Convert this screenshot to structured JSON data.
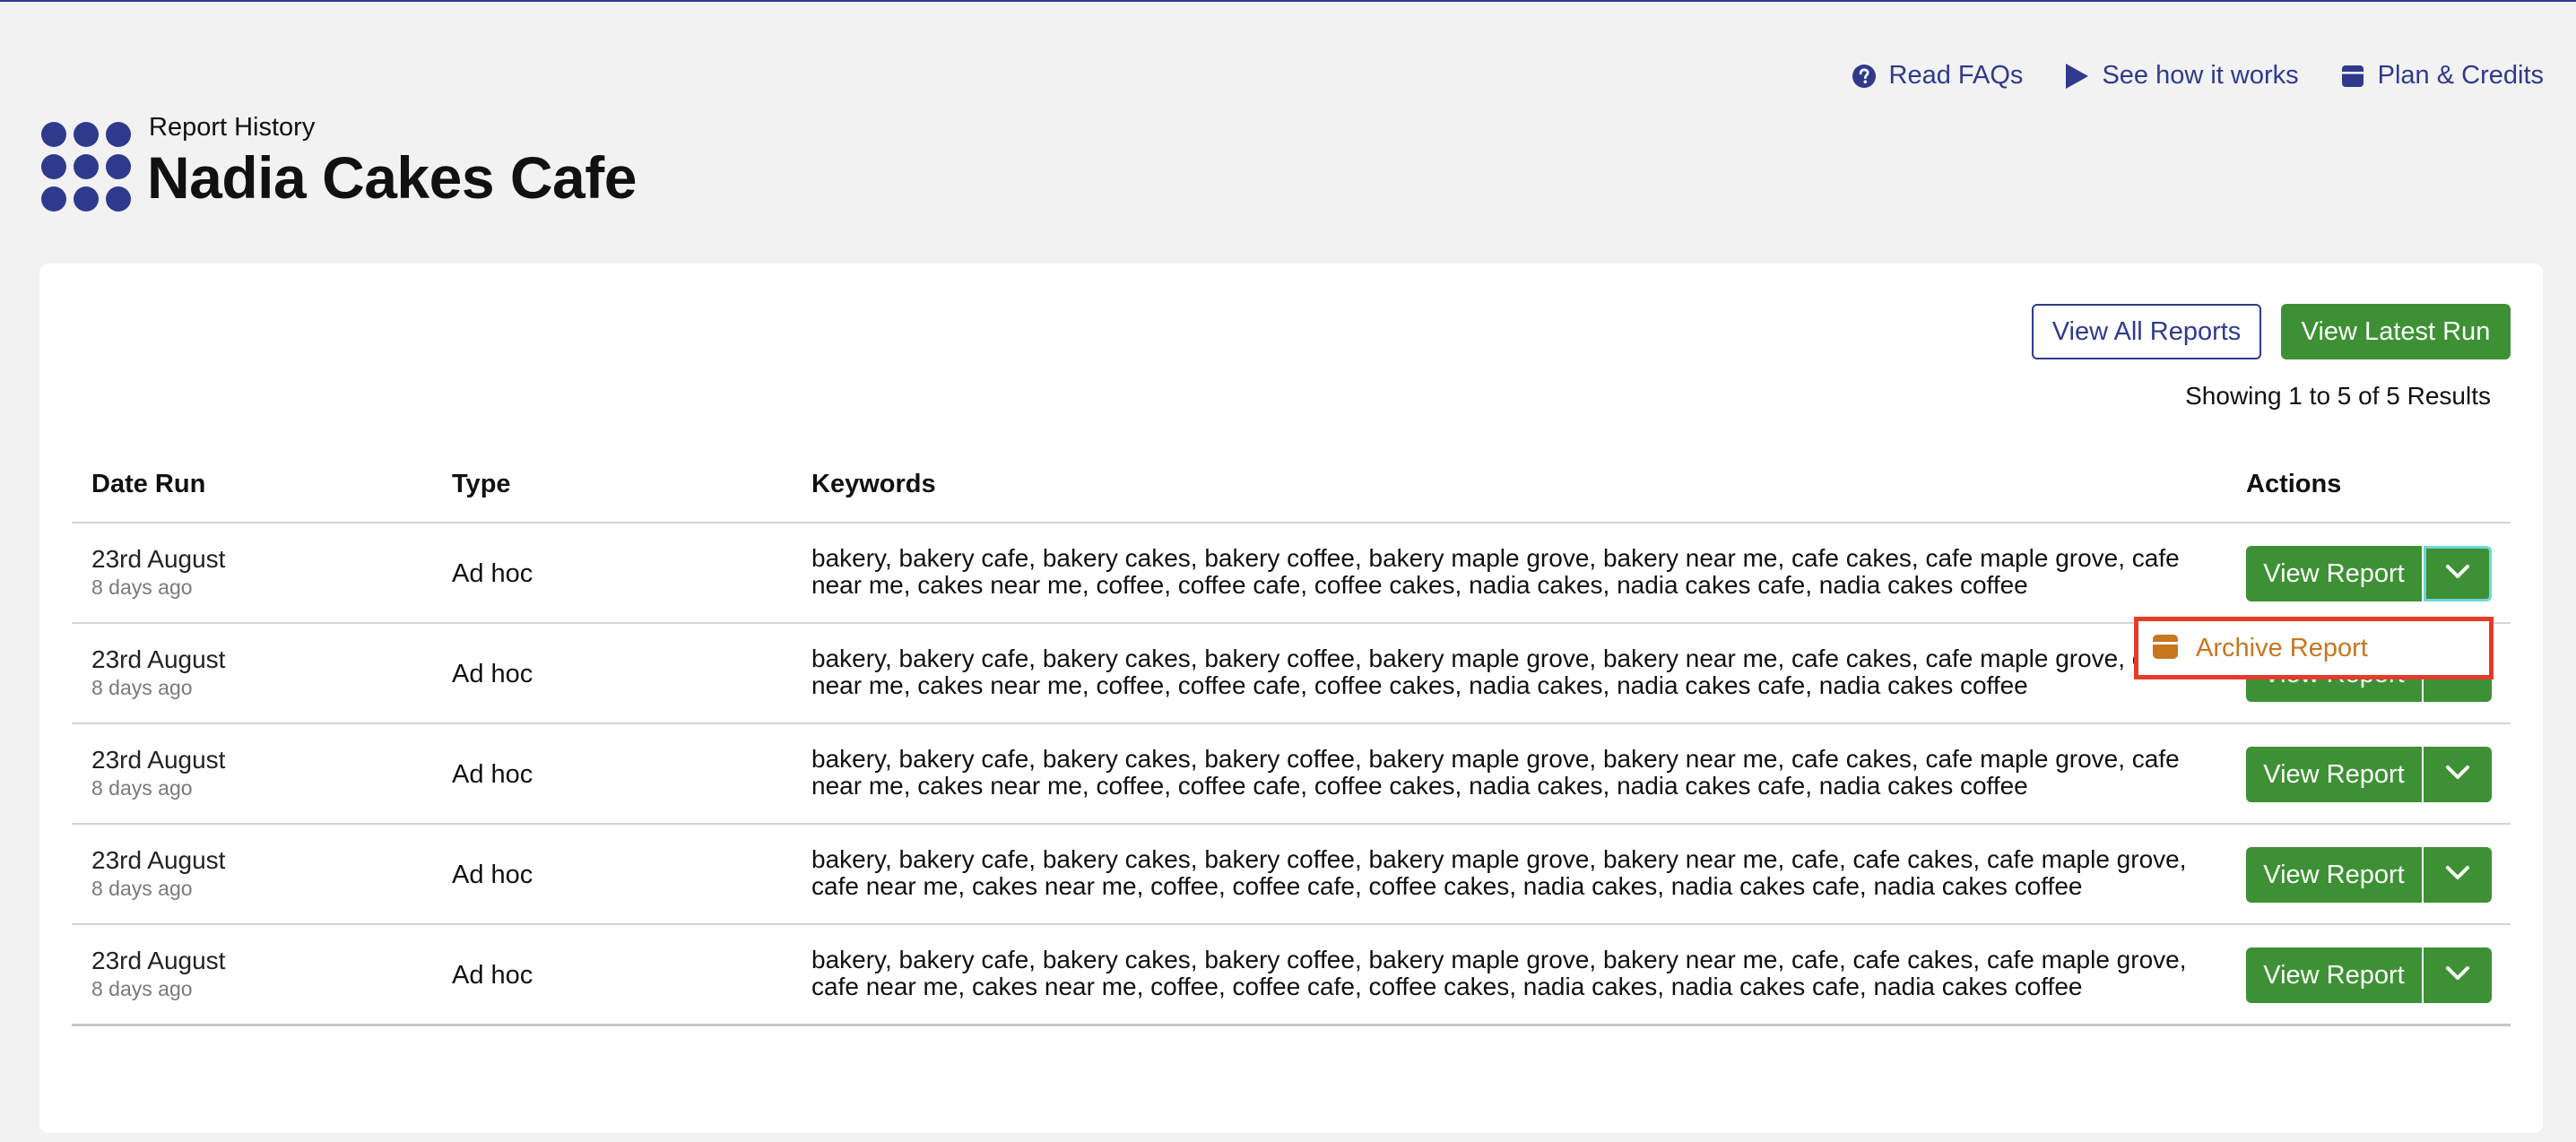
{
  "topnav": {
    "faq": "Read FAQs",
    "how": "See how it works",
    "plan": "Plan & Credits"
  },
  "header": {
    "subtitle": "Report History",
    "title": "Nadia Cakes Cafe"
  },
  "toolbar": {
    "view_all": "View All Reports",
    "view_latest": "View Latest Run",
    "results": "Showing 1 to 5 of 5 Results"
  },
  "table": {
    "headers": [
      "Date Run",
      "Type",
      "Keywords",
      "Actions"
    ],
    "rows": [
      {
        "date": "23rd August",
        "ago": "8 days ago",
        "type": "Ad hoc",
        "keywords": "bakery, bakery cafe, bakery cakes, bakery coffee, bakery maple grove, bakery near me, cafe cakes, cafe maple grove, cafe near me, cakes near me, coffee, coffee cafe, coffee cakes, nadia cakes, nadia cakes cafe, nadia cakes coffee",
        "action": "View Report"
      },
      {
        "date": "23rd August",
        "ago": "8 days ago",
        "type": "Ad hoc",
        "keywords": "bakery, bakery cafe, bakery cakes, bakery coffee, bakery maple grove, bakery near me, cafe cakes, cafe maple grove, cafe near me, cakes near me, coffee, coffee cafe, coffee cakes, nadia cakes, nadia cakes cafe, nadia cakes coffee",
        "action": "View Report"
      },
      {
        "date": "23rd August",
        "ago": "8 days ago",
        "type": "Ad hoc",
        "keywords": "bakery, bakery cafe, bakery cakes, bakery coffee, bakery maple grove, bakery near me, cafe cakes, cafe maple grove, cafe near me, cakes near me, coffee, coffee cafe, coffee cakes, nadia cakes, nadia cakes cafe, nadia cakes coffee",
        "action": "View Report"
      },
      {
        "date": "23rd August",
        "ago": "8 days ago",
        "type": "Ad hoc",
        "keywords": "bakery, bakery cafe, bakery cakes, bakery coffee, bakery maple grove, bakery near me, cafe, cafe cakes, cafe maple grove, cafe near me, cakes near me, coffee, coffee cafe, coffee cakes, nadia cakes, nadia cakes cafe, nadia cakes coffee",
        "action": "View Report"
      },
      {
        "date": "23rd August",
        "ago": "8 days ago",
        "type": "Ad hoc",
        "keywords": "bakery, bakery cafe, bakery cakes, bakery coffee, bakery maple grove, bakery near me, cafe, cafe cakes, cafe maple grove, cafe near me, cakes near me, coffee, coffee cafe, coffee cakes, nadia cakes, nadia cakes cafe, nadia cakes coffee",
        "action": "View Report"
      }
    ]
  },
  "dropdown": {
    "archive": "Archive Report"
  },
  "colors": {
    "brand": "#2f3a8c",
    "green": "#3d9134",
    "archive": "#c8761f",
    "highlight": "#e53b2c"
  }
}
